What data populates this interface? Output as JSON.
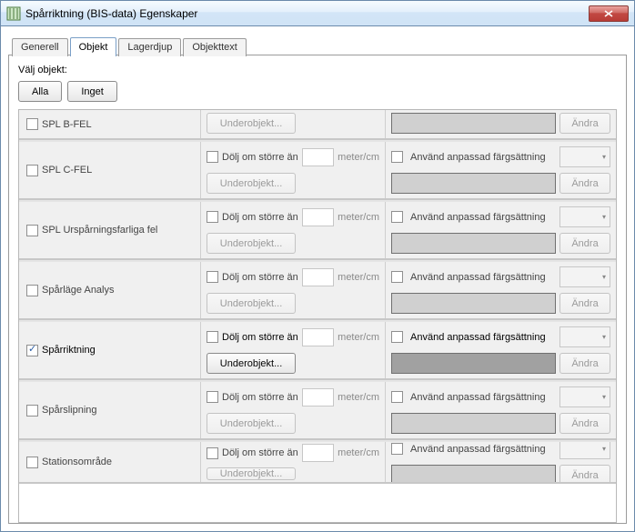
{
  "window": {
    "title": "Spårriktning (BIS-data) Egenskaper"
  },
  "tabs": {
    "generell": "Generell",
    "objekt": "Objekt",
    "lagerdjup": "Lagerdjup",
    "objekttext": "Objekttext"
  },
  "page": {
    "choose_label": "Välj objekt:",
    "btn_all": "Alla",
    "btn_none": "Inget"
  },
  "labels": {
    "hide_if_larger": "Dölj om större än",
    "unit": "meter/cm",
    "subobjects": "Underobjekt...",
    "use_custom_color": "Använd anpassad färgsättning",
    "change": "Ändra"
  },
  "rows": [
    {
      "name": "SPL B-FEL",
      "checked": false,
      "selected": false,
      "short": true
    },
    {
      "name": "SPL C-FEL",
      "checked": false,
      "selected": false,
      "short": false
    },
    {
      "name": "SPL Urspårningsfarliga fel",
      "checked": false,
      "selected": false,
      "short": false
    },
    {
      "name": "Spårläge Analys",
      "checked": false,
      "selected": false,
      "short": false
    },
    {
      "name": "Spårriktning",
      "checked": true,
      "selected": true,
      "short": false
    },
    {
      "name": "Spårslipning",
      "checked": false,
      "selected": false,
      "short": false
    },
    {
      "name": "Stationsområde",
      "checked": false,
      "selected": false,
      "short": false,
      "cut": true
    }
  ]
}
